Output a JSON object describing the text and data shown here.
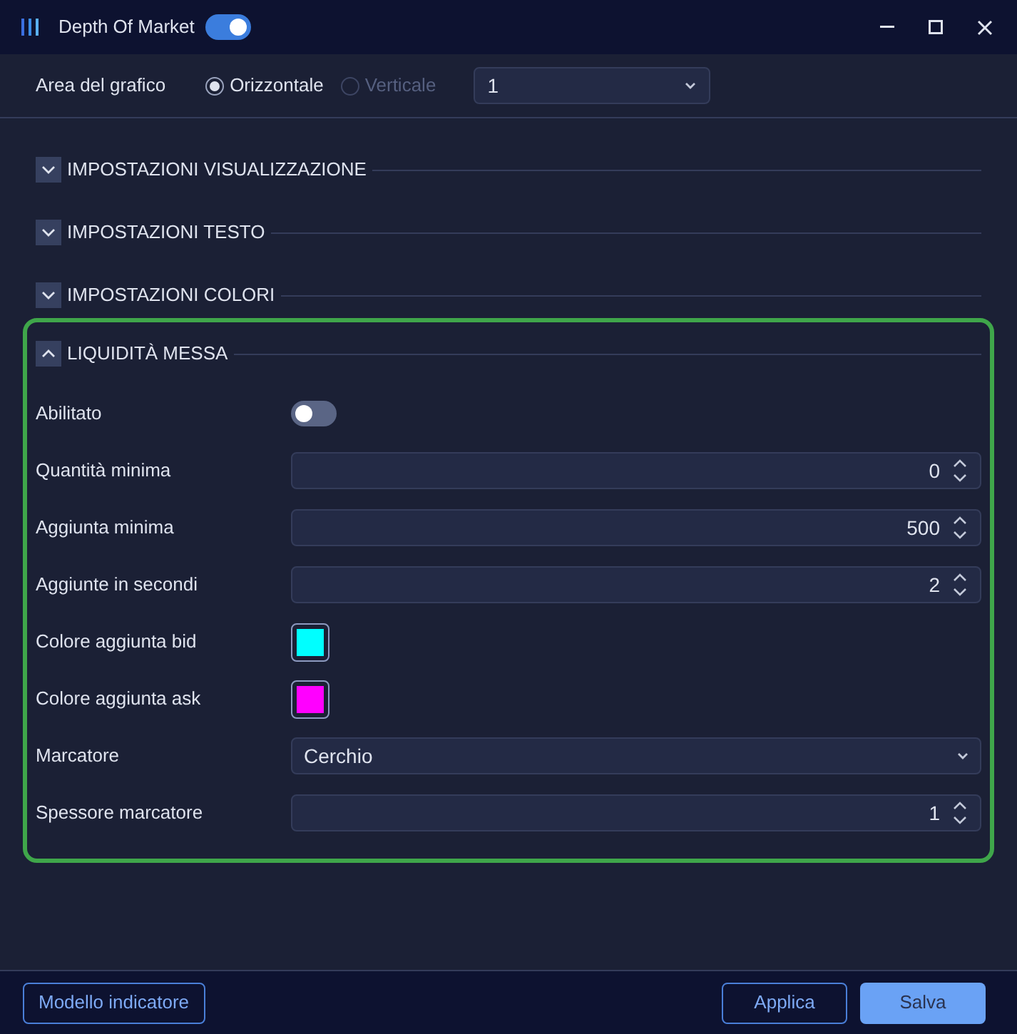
{
  "window": {
    "title": "Depth Of Market",
    "enabled": true
  },
  "toolbar": {
    "label": "Area del grafico",
    "options": [
      {
        "label": "Orizzontale",
        "selected": true,
        "disabled": false
      },
      {
        "label": "Verticale",
        "selected": false,
        "disabled": true
      }
    ],
    "select_value": "1"
  },
  "sections": [
    {
      "title": "IMPOSTAZIONI VISUALIZZAZIONE",
      "expanded": false,
      "focused": false
    },
    {
      "title": "IMPOSTAZIONI TESTO",
      "expanded": false,
      "focused": false
    },
    {
      "title": "IMPOSTAZIONI COLORI",
      "expanded": false,
      "focused": false
    },
    {
      "title": "LIQUIDITÀ MESSA",
      "expanded": true,
      "focused": true,
      "fields": [
        {
          "kind": "toggle",
          "label": "Abilitato",
          "on": false
        },
        {
          "kind": "number",
          "label": "Quantità minima",
          "value": "0"
        },
        {
          "kind": "number",
          "label": "Aggiunta minima",
          "value": "500"
        },
        {
          "kind": "number",
          "label": "Aggiunte in secondi",
          "value": "2"
        },
        {
          "kind": "color",
          "label": "Colore aggiunta bid",
          "color": "#00ffff"
        },
        {
          "kind": "color",
          "label": "Colore aggiunta ask",
          "color": "#ff00ff"
        },
        {
          "kind": "select",
          "label": "Marcatore",
          "value": "Cerchio"
        },
        {
          "kind": "number",
          "label": "Spessore marcatore",
          "value": "1"
        }
      ]
    }
  ],
  "footer": {
    "template_button": "Modello indicatore",
    "apply_button": "Applica",
    "save_button": "Salva"
  }
}
